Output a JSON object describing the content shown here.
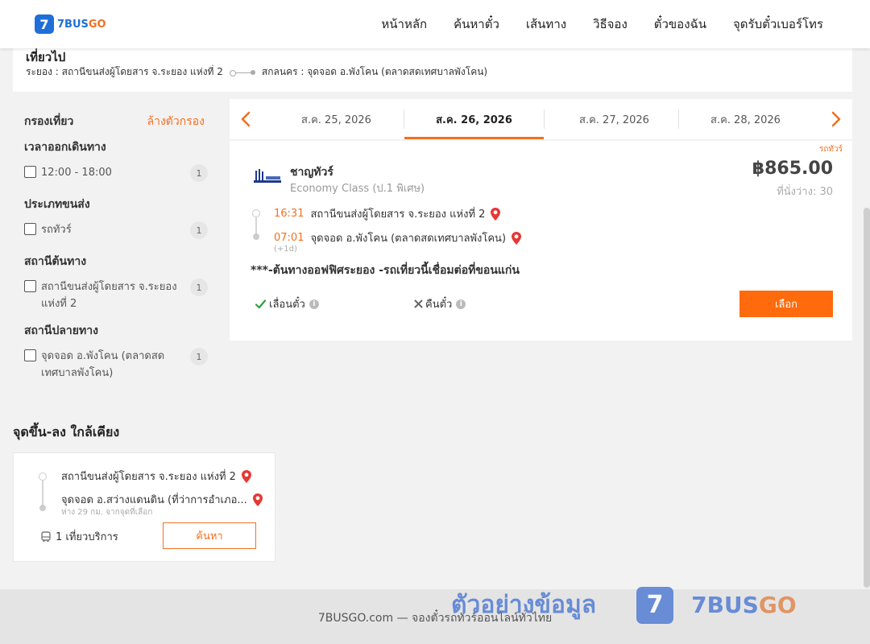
{
  "header": {
    "logo_mark": "7",
    "logo_brand": "7BUS",
    "logo_brand_go": "GO",
    "nav": [
      "หน้าหลัก",
      "ค้นหาตั๋ว",
      "เส้นทาง",
      "วิธีจอง",
      "ตั๋วของฉัน",
      "จุดรับตั๋วเบอร์โทร"
    ]
  },
  "trip": {
    "title": "เที่ยวไป",
    "from": "ระยอง : สถานีขนส่งผู้โดยสาร จ.ระยอง แห่งที่ 2",
    "to": "สกลนคร : จุดจอด อ.พังโคน (ตลาดสดเทศบาลพังโคน)"
  },
  "filter": {
    "title": "กรองเที่ยว",
    "clear_label": "ล้างตัวกรอง",
    "groups": [
      {
        "title": "เวลาออกเดินทาง",
        "option": "12:00 - 18:00",
        "count": "1"
      },
      {
        "title": "ประเภทขนส่ง",
        "option": "รถทัวร์",
        "count": "1"
      },
      {
        "title": "สถานีต้นทาง",
        "option": "สถานีขนส่งผู้โดยสาร จ.ระยอง แห่งที่ 2",
        "count": "1"
      },
      {
        "title": "สถานีปลายทาง",
        "option": "จุดจอด อ.พังโคน (ตลาดสดเทศบาลพังโคน)",
        "count": "1"
      }
    ]
  },
  "dates": {
    "tabs": [
      "ส.ค. 25, 2026",
      "ส.ค. 26, 2026",
      "ส.ค. 27, 2026",
      "ส.ค. 28, 2026"
    ],
    "active_index": 1
  },
  "result": {
    "tag": "รถทัวร์",
    "operator": "ชาญทัวร์",
    "class": "Economy Class (ป.1 พิเศษ)",
    "price": "฿865.00",
    "seats": "ที่นั่งว่าง: 30",
    "depart_time": "16:31",
    "depart_stop": "สถานีขนส่งผู้โดยสาร จ.ระยอง แห่งที่ 2",
    "arrive_time": "07:01",
    "arrive_stop": "จุดจอด อ.พังโคน (ตลาดสดเทศบาลพังโคน)",
    "next_day": "(+1d)",
    "note": "***-ต้นทางออฟฟิศระยอง -รถเที่ยวนี้เชื่อมต่อที่ขอนแก่น",
    "reschedule": "เลื่อนตั๋ว",
    "refund": "คืนตั๋ว",
    "select_label": "เลือก"
  },
  "nearby": {
    "title": "จุดขึ้น-ลง ใกล้เคียง",
    "stop1": "สถานีขนส่งผู้โดยสาร จ.ระยอง แห่งที่ 2",
    "stop2": "จุดจอด อ.สว่างแดนดิน (ที่ว่าการอำเภอ...",
    "distance": "ห่าง 29 กม. จากจุดที่เลือก",
    "trips": "1 เที่ยวบริการ",
    "search_label": "ค้นหา"
  },
  "footer": {
    "text": "7BUSGO.com — จองตั๋วรถทัวร์ออนไลน์ทั่วไทย",
    "watermark_text": "ตัวอย่างข้อมูล",
    "watermark_mark": "7",
    "watermark_brand": "7BUS",
    "watermark_brand_go": "GO"
  },
  "colors": {
    "accent": "#f37021",
    "button": "#ff6a0c",
    "brand_blue": "#1f6fd6",
    "pin_red": "#e53935"
  }
}
